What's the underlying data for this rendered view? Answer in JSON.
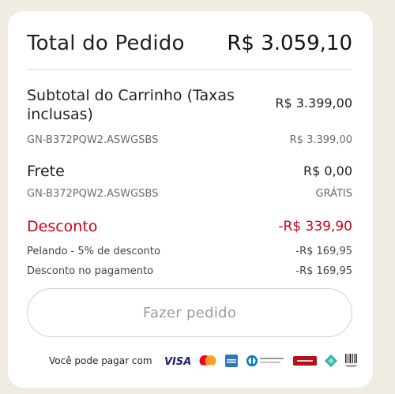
{
  "summary": {
    "total_label": "Total do Pedido",
    "total_value": "R$ 3.059,10",
    "subtotal_label": "Subtotal do Carrinho (Taxas inclusas)",
    "subtotal_value": "R$ 3.399,00",
    "subtotal_item_code": "GN-B372PQW2.ASWGSBS",
    "subtotal_item_value": "R$ 3.399,00",
    "shipping_label": "Frete",
    "shipping_value": "R$ 0,00",
    "shipping_item_code": "GN-B372PQW2.ASWGSBS",
    "shipping_item_value": "GRÁTIS",
    "discount_label": "Desconto",
    "discount_value": "-R$ 339,90",
    "discount_items": [
      {
        "label": "Pelando - 5% de desconto",
        "value": "-R$ 169,95"
      },
      {
        "label": "Desconto no pagamento",
        "value": "-R$ 169,95"
      }
    ]
  },
  "actions": {
    "place_order_label": "Fazer pedido"
  },
  "payment": {
    "label": "Você pode pagar com",
    "visa_text": "VISA",
    "methods": [
      "visa-icon",
      "mastercard-icon",
      "amex-icon",
      "diners-club-icon",
      "hipercard-icon",
      "elo-icon",
      "boleto-icon"
    ]
  },
  "colors": {
    "discount": "#d0021b",
    "background": "#f0ece4"
  }
}
